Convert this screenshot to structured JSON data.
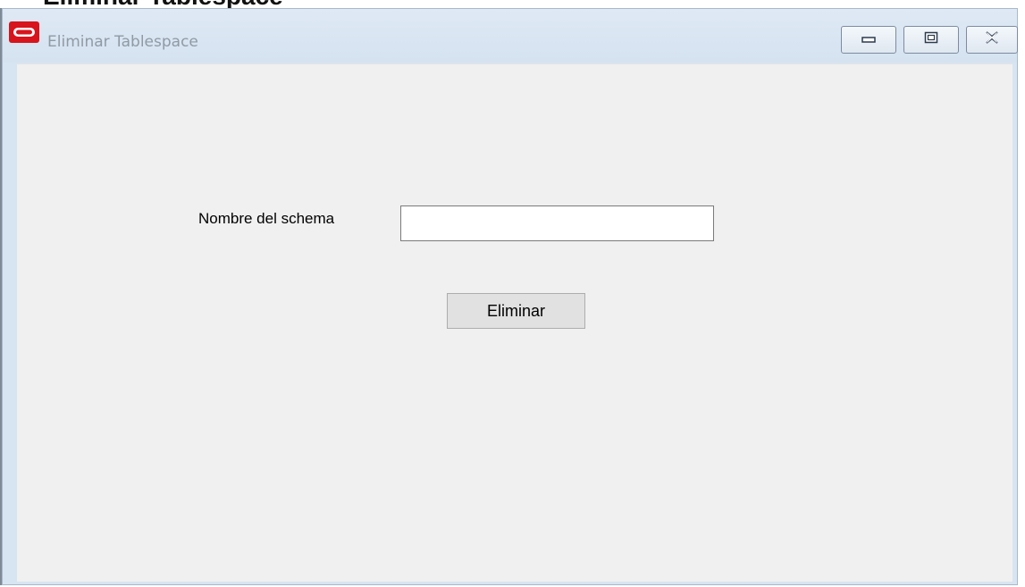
{
  "document": {
    "heading_fragment": "Eliminar Tablespace"
  },
  "window": {
    "title": "Eliminar Tablespace",
    "app_icon": "oracle-logo-icon",
    "controls": {
      "minimize_icon": "minimize-icon",
      "maximize_icon": "maximize-icon",
      "close_icon": "close-icon"
    }
  },
  "form": {
    "schema_label": "Nombre del schema",
    "schema_value": "",
    "schema_placeholder": "",
    "submit_label": "Eliminar"
  },
  "colors": {
    "titlebar": "#d7e4f2",
    "client_background": "#f0f0f0",
    "icon_red": "#d8141c",
    "button_face": "#e1e1e1"
  }
}
